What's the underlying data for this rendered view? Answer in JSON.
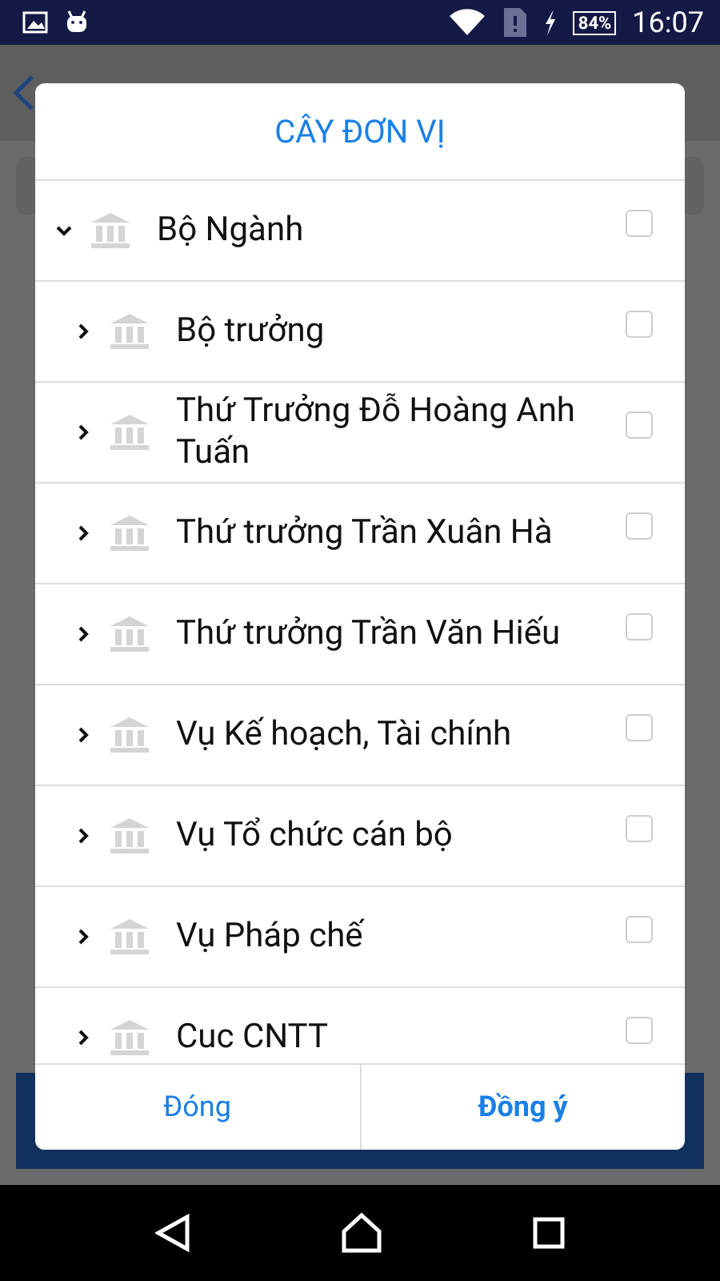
{
  "status_bar": {
    "battery": "84%",
    "time": "16:07"
  },
  "dialog": {
    "title": "CÂY ĐƠN VỊ",
    "tree": [
      {
        "label": "Bộ Ngành",
        "expanded": true,
        "checked": false,
        "children": [
          {
            "label": "Bộ trưởng",
            "expanded": false,
            "checked": false
          },
          {
            "label": "Thứ Trưởng Đỗ Hoàng Anh Tuấn",
            "expanded": false,
            "checked": false
          },
          {
            "label": "Thứ trưởng Trần Xuân Hà",
            "expanded": false,
            "checked": false
          },
          {
            "label": "Thứ trưởng Trần Văn Hiếu",
            "expanded": false,
            "checked": false
          },
          {
            "label": "Vụ Kế hoạch, Tài chính",
            "expanded": false,
            "checked": false
          },
          {
            "label": "Vụ Tổ chức cán bộ",
            "expanded": false,
            "checked": false
          },
          {
            "label": "Vụ Pháp chế",
            "expanded": false,
            "checked": false
          },
          {
            "label": "Cuc CNTT",
            "expanded": false,
            "checked": false
          }
        ]
      }
    ],
    "buttons": [
      {
        "label": "Đóng",
        "primary": false
      },
      {
        "label": "Đồng ý",
        "primary": true
      }
    ]
  }
}
